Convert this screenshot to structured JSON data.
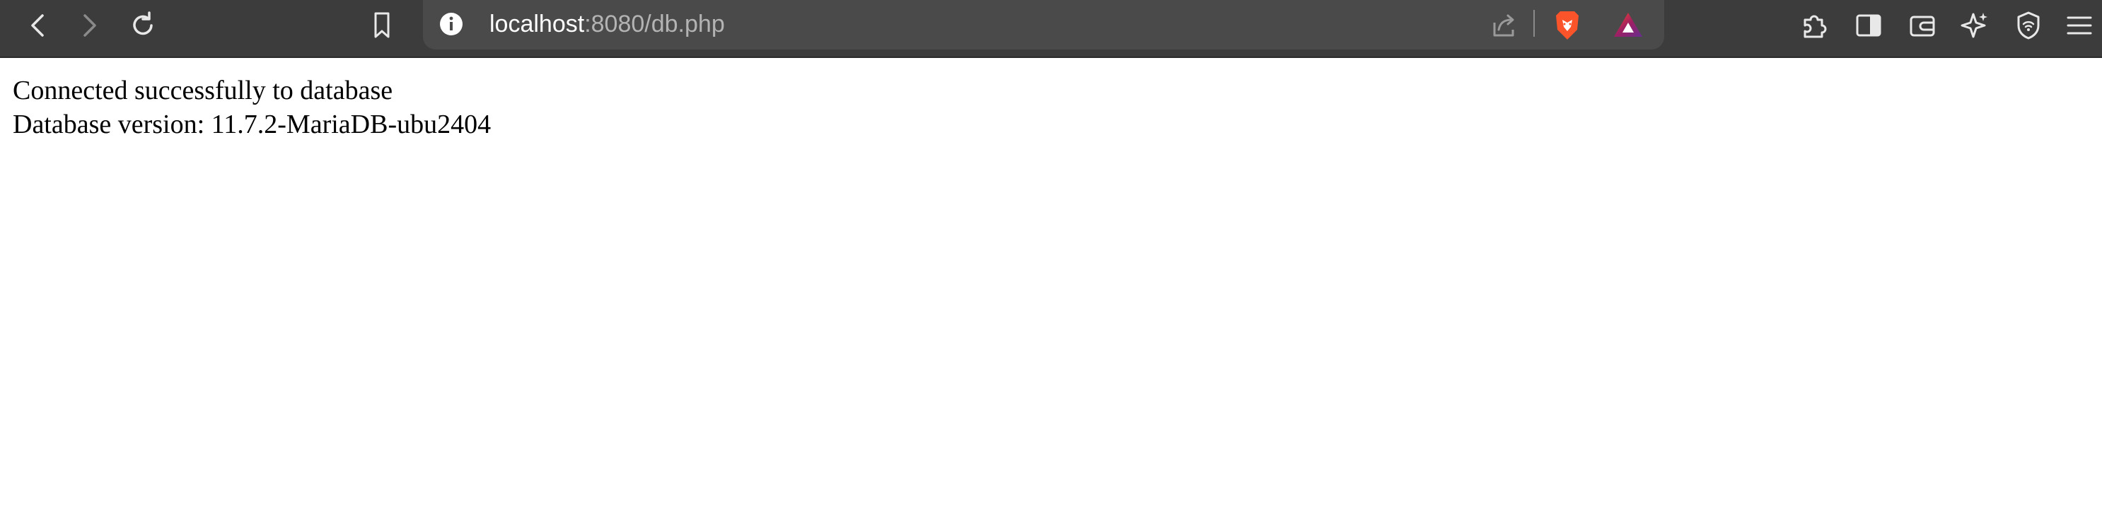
{
  "browser": {
    "url_host": "localhost",
    "url_path": ":8080/db.php",
    "icons": {
      "back": "back-arrow-icon",
      "forward": "forward-arrow-icon",
      "reload": "reload-icon",
      "bookmark": "bookmark-icon",
      "site_info": "info-icon",
      "share": "share-icon",
      "brave_shields": "brave-lion-icon",
      "brave_rewards": "brave-rewards-triangle-icon",
      "extensions": "puzzle-piece-icon",
      "sidebar": "sidebar-toggle-icon",
      "wallet": "wallet-icon",
      "leo": "sparkle-icon",
      "vpn": "shield-wifi-icon",
      "menu": "hamburger-menu-icon"
    },
    "colors": {
      "toolbar": "#3c3c3c",
      "urlbar": "#4a4a4a",
      "icon": "#e8e8e8",
      "brave_orange": "#fb542b"
    }
  },
  "page": {
    "line1": "Connected successfully to database",
    "line2": "Database version: 11.7.2-MariaDB-ubu2404"
  }
}
